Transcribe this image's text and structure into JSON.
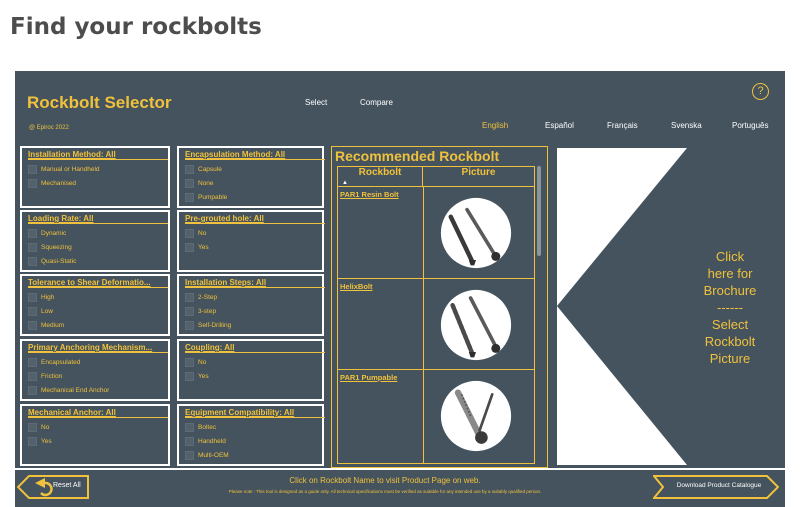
{
  "page": {
    "title": "Find your rockbolts"
  },
  "app": {
    "title": "Rockbolt Selector",
    "copyright": "@ Epiroc 2022",
    "help_symbol": "?"
  },
  "nav": {
    "select": "Select",
    "compare": "Compare"
  },
  "languages": [
    {
      "label": "English",
      "active": true
    },
    {
      "label": "Español",
      "active": false
    },
    {
      "label": "Français",
      "active": false
    },
    {
      "label": "Svenska",
      "active": false
    },
    {
      "label": "Português",
      "active": false
    }
  ],
  "filters": [
    {
      "title": "Installation Method: All",
      "options": [
        "Manual or Handheld",
        "Mechanised"
      ]
    },
    {
      "title": "Encapsulation Method: All",
      "options": [
        "Capsule",
        "None",
        "Pumpable"
      ]
    },
    {
      "title": "Loading Rate: All",
      "options": [
        "Dynamic",
        "Squeezing",
        "Quasi-Static"
      ]
    },
    {
      "title": "Pre-grouted hole: All",
      "options": [
        "No",
        "Yes"
      ]
    },
    {
      "title": "Tolerance to Shear Deformatio...",
      "options": [
        "High",
        "Low",
        "Medium"
      ]
    },
    {
      "title": "Installation Steps: All",
      "options": [
        "2-Step",
        "3-step",
        "Self-Drilling"
      ]
    },
    {
      "title": "Primary Anchoring Mechanism...",
      "options": [
        "Encapsulated",
        "Friction",
        "Mechanical End Anchor"
      ]
    },
    {
      "title": "Coupling: All",
      "options": [
        "No",
        "Yes"
      ]
    },
    {
      "title": "Mechanical Anchor: All",
      "options": [
        "No",
        "Yes"
      ]
    },
    {
      "title": "Equipment Compatibility: All",
      "options": [
        "Boltec",
        "Handheld",
        "Multi-OEM"
      ]
    }
  ],
  "recommended": {
    "title": "Recommended Rockbolt",
    "col_rockbolt": "Rockbolt",
    "col_picture": "Picture",
    "sort_icon": "caret-up-icon",
    "rows": [
      {
        "name": "PAR1 Resin Bolt",
        "picture_icon": "resin-bolt-picture"
      },
      {
        "name": "HelixBolt",
        "picture_icon": "helix-bolt-picture"
      },
      {
        "name": "PAR1 Pumpable",
        "picture_icon": "pumpable-bolt-picture"
      }
    ]
  },
  "brochure": {
    "text": "Click\nhere for\nBrochure\n------\nSelect\nRockbolt\nPicture"
  },
  "footer": {
    "reset_label": "Reset All",
    "main_text": "Click on Rockbolt Name to visit Product Page on web.",
    "note": "Please note : This tool is designed as a guide only. All technical specifications must be verified as suitable for any intended use by a suitably qualified person.",
    "download_label": "Download Product Catalogue"
  },
  "colors": {
    "panel": "#44535e",
    "accent": "#f0c13c",
    "white": "#ffffff"
  }
}
